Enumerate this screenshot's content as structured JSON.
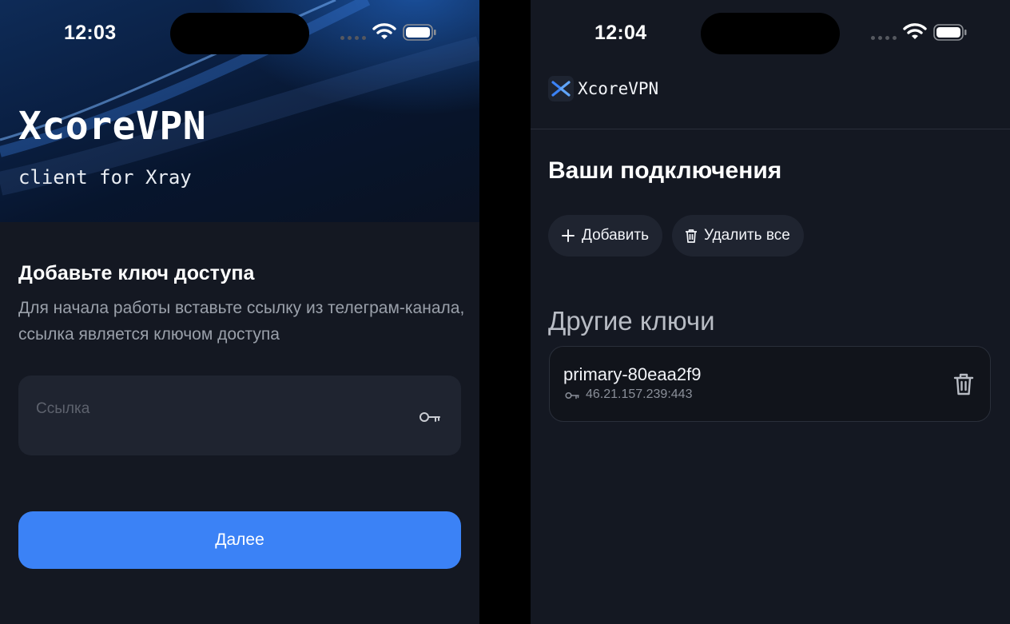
{
  "left_screen": {
    "status": {
      "time": "12:03"
    },
    "hero": {
      "title": "XcoreVPN",
      "subtitle": "client for Xray"
    },
    "section_title": "Добавьте ключ доступа",
    "description": "Для начала работы вставьте ссылку из телеграм-канала, ссылка является ключом доступа",
    "link_input": {
      "placeholder": "Ссылка",
      "value": ""
    },
    "next_button": "Далее"
  },
  "right_screen": {
    "status": {
      "time": "12:04"
    },
    "app_name": "XcoreVPN",
    "connections_title": "Ваши подключения",
    "add_button": "Добавить",
    "delete_all_button": "Удалить все",
    "other_keys_title": "Другие ключи",
    "keys": [
      {
        "name": "primary-80eaa2f9",
        "address": "46.21.157.239:443"
      }
    ]
  },
  "colors": {
    "background": "#141822",
    "card": "#1f2430",
    "accent": "#3b82f6",
    "muted_text": "#9aa0aa"
  },
  "icons": [
    "wifi-icon",
    "battery-icon",
    "key-icon",
    "plus-icon",
    "trash-icon",
    "x-logo-icon"
  ]
}
